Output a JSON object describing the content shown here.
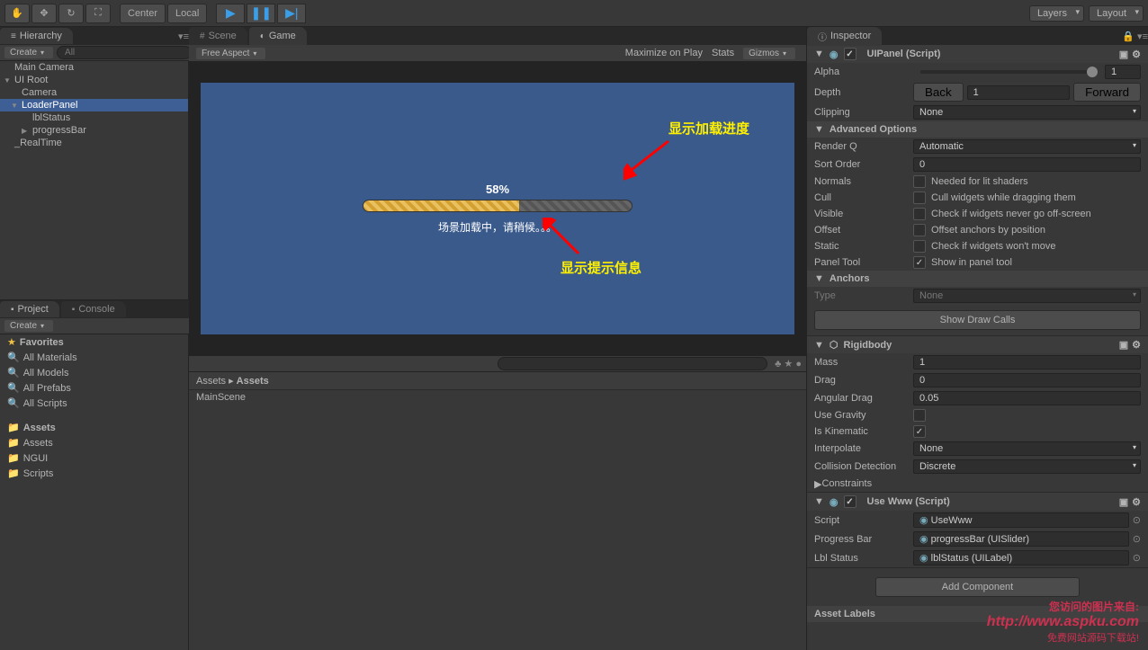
{
  "toolbar": {
    "center_btn": "Center",
    "local_btn": "Local",
    "layers": "Layers",
    "layout": "Layout"
  },
  "hierarchy": {
    "tab": "Hierarchy",
    "create": "Create",
    "items": [
      {
        "name": "Main Camera",
        "indent": 0
      },
      {
        "name": "UI Root",
        "indent": 0,
        "toggle": "▼"
      },
      {
        "name": "Camera",
        "indent": 1
      },
      {
        "name": "LoaderPanel",
        "indent": 1,
        "toggle": "▼",
        "selected": true
      },
      {
        "name": "lblStatus",
        "indent": 2
      },
      {
        "name": "progressBar",
        "indent": 2,
        "toggle": "▶"
      },
      {
        "name": "_RealTime",
        "indent": 0
      }
    ]
  },
  "scene_tabs": {
    "scene": "Scene",
    "game": "Game"
  },
  "game_toolbar": {
    "aspect": "Free Aspect",
    "maximize": "Maximize on Play",
    "stats": "Stats",
    "gizmos": "Gizmos"
  },
  "game_view": {
    "progress_pct": "58%",
    "status_text": "场景加载中，请稍候。。。",
    "annotation_progress": "显示加载进度",
    "annotation_status": "显示提示信息"
  },
  "project": {
    "tab_project": "Project",
    "tab_console": "Console",
    "create": "Create",
    "favorites": "Favorites",
    "fav_items": [
      "All Materials",
      "All Models",
      "All Prefabs",
      "All Scripts"
    ],
    "assets": "Assets",
    "folders": [
      "Assets",
      "NGUI",
      "Scripts"
    ],
    "breadcrumb": [
      "Assets",
      "Assets"
    ],
    "content": [
      "MainScene"
    ]
  },
  "inspector": {
    "tab": "Inspector",
    "uipanel": {
      "title": "UIPanel (Script)",
      "alpha": "Alpha",
      "alpha_val": "1",
      "depth": "Depth",
      "depth_back": "Back",
      "depth_val": "1",
      "depth_forward": "Forward",
      "clipping": "Clipping",
      "clipping_val": "None",
      "advanced": "Advanced Options",
      "renderq": "Render Q",
      "renderq_val": "Automatic",
      "sortorder": "Sort Order",
      "sortorder_val": "0",
      "normals": "Normals",
      "normals_hint": "Needed for lit shaders",
      "cull": "Cull",
      "cull_hint": "Cull widgets while dragging them",
      "visible": "Visible",
      "visible_hint": "Check if widgets never go off-screen",
      "offset": "Offset",
      "offset_hint": "Offset anchors by position",
      "static": "Static",
      "static_hint": "Check if widgets won't move",
      "paneltool": "Panel Tool",
      "paneltool_hint": "Show in panel tool",
      "anchors": "Anchors",
      "type": "Type",
      "type_val": "None",
      "drawcalls": "Show Draw Calls"
    },
    "rigidbody": {
      "title": "Rigidbody",
      "mass": "Mass",
      "mass_val": "1",
      "drag": "Drag",
      "drag_val": "0",
      "angular": "Angular Drag",
      "angular_val": "0.05",
      "gravity": "Use Gravity",
      "kinematic": "Is Kinematic",
      "interpolate": "Interpolate",
      "interpolate_val": "None",
      "collision": "Collision Detection",
      "collision_val": "Discrete",
      "constraints": "Constraints"
    },
    "usewww": {
      "title": "Use Www (Script)",
      "script": "Script",
      "script_val": "UseWww",
      "progressbar": "Progress Bar",
      "progressbar_val": "progressBar (UISlider)",
      "lblstatus": "Lbl Status",
      "lblstatus_val": "lblStatus (UILabel)"
    },
    "addcomponent": "Add Component",
    "assetlabels": "Asset Labels"
  },
  "watermark": {
    "line1": "您访问的图片来自:",
    "line2": "http://www.aspku.com",
    "line3": "免费网站源码下载站!"
  }
}
